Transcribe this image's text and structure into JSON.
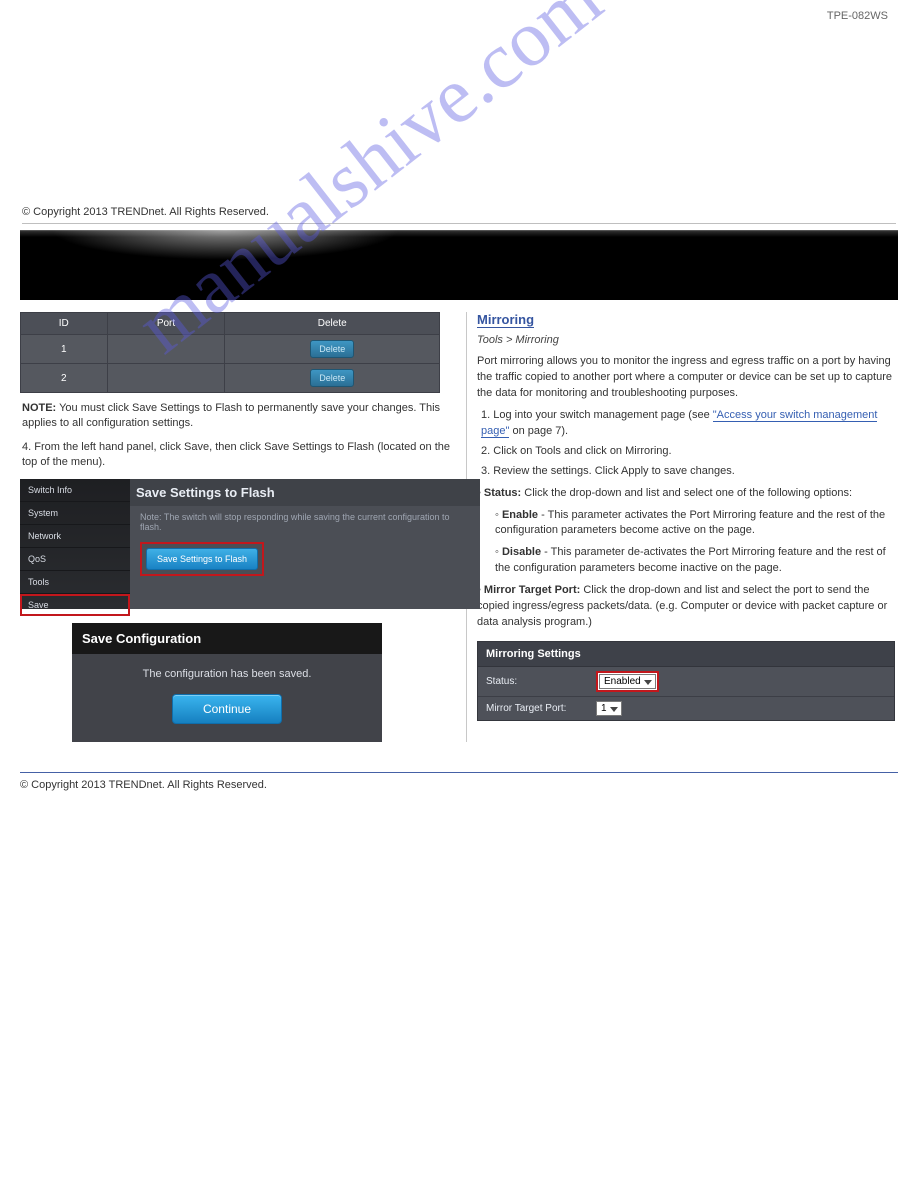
{
  "header": {
    "left": " ",
    "right": "TPE-082WS"
  },
  "top_blurb": "© Copyright 2013 TRENDnet. All Rights Reserved.",
  "ports_table": {
    "cols": [
      "ID",
      "Port",
      "Delete"
    ],
    "rows": [
      {
        "id": "1",
        "port": "",
        "delete": "Delete"
      },
      {
        "id": "2",
        "port": "",
        "delete": "Delete"
      }
    ]
  },
  "left": {
    "para1_pre": "NOTE:",
    "para1": " You must click Save Settings to Flash to permanently save your changes. This applies to all configuration settings.",
    "para2": "4.  From the left hand panel, click Save, then click Save Settings to Flash (located on the top of the menu).",
    "ssf": {
      "nav": [
        "Switch Info",
        "System",
        "Network",
        "QoS",
        "Tools",
        "Save"
      ],
      "selected": "Save",
      "title": "Save Settings to Flash",
      "note": "Note: The switch will stop responding while saving the current configuration to flash.",
      "btn": "Save Settings to Flash"
    },
    "sc": {
      "title": "Save Configuration",
      "msg": "The configuration has been saved.",
      "btn": "Continue"
    }
  },
  "right": {
    "heading": "Mirroring",
    "sub": "Tools > Mirroring",
    "p1": "Port mirroring allows you to monitor the ingress and egress traffic on a port by having the traffic copied to another port where a computer or device can be set up to capture the data for monitoring and troubleshooting purposes.",
    "step1_num": "1.",
    "step1": "  Log into your switch management page (see ",
    "step1_link": "\"Access your switch management page\"",
    "step1_tail": " on page 7).",
    "step2_num": "2.",
    "step2": "  Click on Tools and click on Mirroring.",
    "step3_num": "3.",
    "step3": "  Review the settings. Click Apply to save changes.",
    "bullets": [
      {
        "lead": "Status:",
        "text": " Click the drop-down and list and select one of the following options:"
      },
      {
        "lead": "Enable",
        "text": " - This parameter activates the Port Mirroring feature and the rest of the configuration parameters become active on the page."
      },
      {
        "lead": "Disable",
        "text": " - This parameter de-activates the Port Mirroring feature and the rest of the configuration parameters become inactive on the page."
      }
    ],
    "mtp_lead": "Mirror Target Port:",
    "mtp_text": " Click the drop-down and list and select the port to send the copied ingress/egress packets/data. (e.g. Computer or device with packet capture or data analysis program.)",
    "mir": {
      "title": "Mirroring Settings",
      "status_label": "Status:",
      "status_value": "Enabled",
      "port_label": "Mirror Target Port:",
      "port_value": "1"
    }
  },
  "footer": {
    "copy": "© Copyright 2013 TRENDnet. All Rights Reserved.",
    "page": " "
  },
  "watermark": "manualshive.com"
}
